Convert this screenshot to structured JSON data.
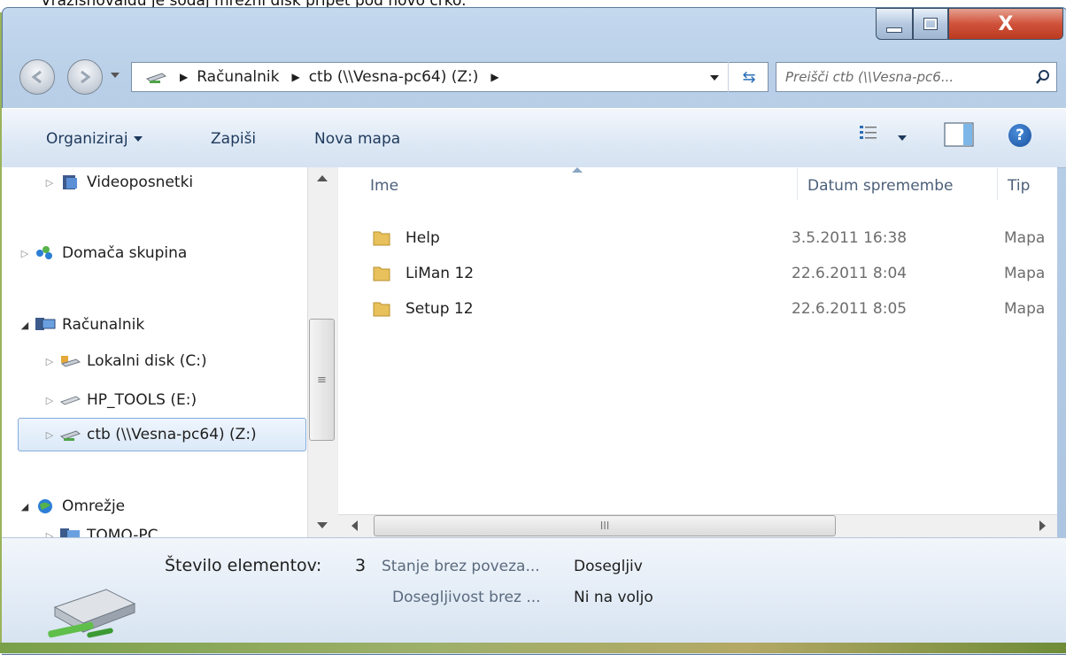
{
  "caption": "Vrazišnovaldu je sodaj mrežni disk pripet pod novo črko.",
  "window": {
    "title_buttons": [
      "minimize",
      "maximize",
      "close"
    ],
    "close_glyph": "X"
  },
  "address_bar": {
    "segments": [
      "Računalnik",
      "ctb (\\\\Vesna-pc64) (Z:)"
    ],
    "refresh_glyph": "⇆"
  },
  "search": {
    "placeholder": "Preišči ctb (\\\\Vesna-pc6..."
  },
  "toolbar": {
    "organize": "Organiziraj",
    "burn": "Zapiši",
    "new_folder": "Nova mapa",
    "help": "?"
  },
  "nav": {
    "items": [
      {
        "label": "Videoposnetki",
        "icon": "video-library-icon"
      },
      {
        "label": "Domača skupina",
        "icon": "homegroup-icon"
      },
      {
        "label": "Računalnik",
        "icon": "computer-icon"
      },
      {
        "label": "Lokalni disk (C:)",
        "icon": "local-disk-icon"
      },
      {
        "label": "HP_TOOLS (E:)",
        "icon": "drive-icon"
      },
      {
        "label": "ctb (\\\\Vesna-pc64) (Z:)",
        "icon": "network-drive-icon"
      },
      {
        "label": "Omrežje",
        "icon": "network-icon"
      },
      {
        "label": "TOMO-PC",
        "icon": "computer-icon"
      }
    ],
    "selected": "ctb (\\\\Vesna-pc64) (Z:)"
  },
  "columns": {
    "name": "Ime",
    "date": "Datum spremembe",
    "type": "Tip"
  },
  "files": [
    {
      "name": "Help",
      "date": "3.5.2011 16:38",
      "type": "Mapa"
    },
    {
      "name": "LiMan 12",
      "date": "22.6.2011 8:04",
      "type": "Mapa"
    },
    {
      "name": "Setup 12",
      "date": "22.6.2011 8:05",
      "type": "Mapa"
    }
  ],
  "details": {
    "count_label": "Število elementov:",
    "count_value": "3",
    "offline_status_label": "Stanje brez poveza...",
    "offline_status_value": "Dosegljiv",
    "offline_avail_label": "Dosegljivost brez ...",
    "offline_avail_value": "Ni na voljo"
  },
  "colors": {
    "accent": "#1e395b",
    "window_frame": "#b8cfe7",
    "selection": "#dbe9f8",
    "close": "#d0523b"
  }
}
